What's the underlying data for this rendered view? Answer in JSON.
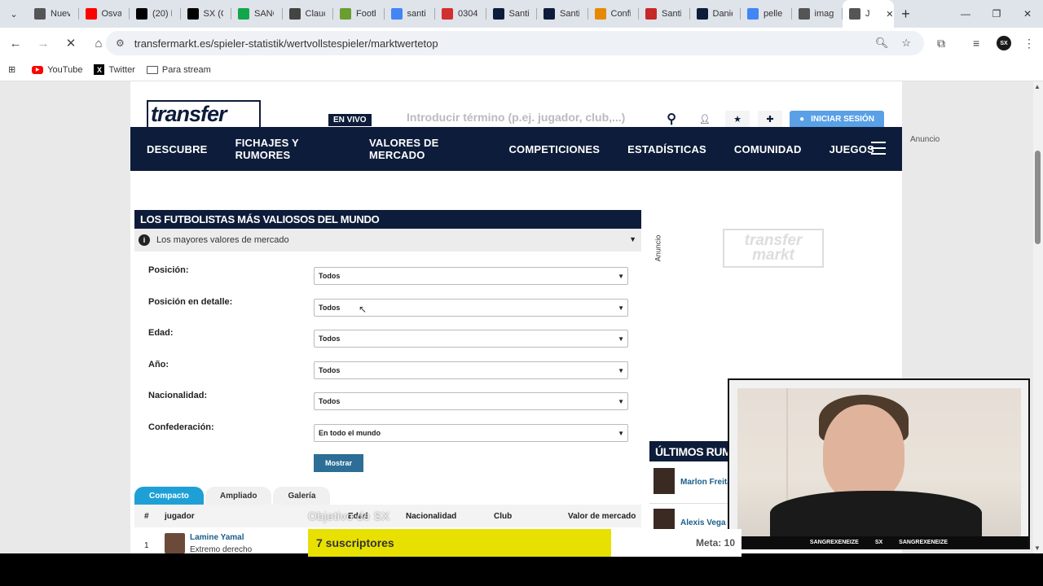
{
  "browser": {
    "tabs": [
      {
        "title": "Nuev",
        "color": "#555"
      },
      {
        "title": "Osval",
        "color": "#ff0000"
      },
      {
        "title": "(20) E",
        "color": "#000"
      },
      {
        "title": "SX (C",
        "color": "#000"
      },
      {
        "title": "SANC",
        "color": "#12a64b"
      },
      {
        "title": "Clauc",
        "color": "#444"
      },
      {
        "title": "Footb",
        "color": "#6a9e2f"
      },
      {
        "title": "santi",
        "color": "#4285f4"
      },
      {
        "title": "0304",
        "color": "#d32f2f"
      },
      {
        "title": "Santi",
        "color": "#0d1c3a"
      },
      {
        "title": "Santi",
        "color": "#0d1c3a"
      },
      {
        "title": "Confi",
        "color": "#e58a00"
      },
      {
        "title": "Santi",
        "color": "#c62828"
      },
      {
        "title": "Danie",
        "color": "#0d1c3a"
      },
      {
        "title": "pelle",
        "color": "#4285f4"
      },
      {
        "title": "imag",
        "color": "#555"
      },
      {
        "title": "J",
        "color": "#555"
      }
    ],
    "url": "transfermarkt.es/spieler-statistik/wertvollstespieler/marktwertetop",
    "profile_initials": "SX",
    "bookmarks": [
      {
        "label": "YouTube",
        "icon": "youtube-icon"
      },
      {
        "label": "Twitter",
        "icon": "x-icon"
      },
      {
        "label": "Para stream",
        "icon": "folder-icon"
      }
    ]
  },
  "site": {
    "logo_text": "transfer",
    "live_badge": "EN VIVO",
    "search_placeholder": "Introducir término (p.ej. jugador, club,...)",
    "login_label": "INICIAR SESIÓN",
    "nav": [
      "DESCUBRE",
      "FICHAJES Y RUMORES",
      "VALORES DE MERCADO",
      "COMPETICIONES",
      "ESTADÍSTICAS",
      "COMUNIDAD",
      "JUEGOS"
    ],
    "ad_label": "Anuncio",
    "side_ad_label": "Anuncio",
    "side_logo_line1": "transfer",
    "side_logo_line2": "markt"
  },
  "box": {
    "title": "LOS FUTBOLISTAS MÁS VALIOSOS DEL MUNDO",
    "subtitle": "Los mayores valores de mercado",
    "filters": [
      {
        "label": "Posición:",
        "value": "Todos"
      },
      {
        "label": "Posición en detalle:",
        "value": "Todos"
      },
      {
        "label": "Edad:",
        "value": "Todos"
      },
      {
        "label": "Año:",
        "value": "Todos"
      },
      {
        "label": "Nacionalidad:",
        "value": "Todos"
      },
      {
        "label": "Confederación:",
        "value": "En todo el mundo"
      }
    ],
    "submit_label": "Mostrar",
    "view_tabs": [
      "Compacto",
      "Ampliado",
      "Galería"
    ],
    "columns": [
      "#",
      "jugador",
      "Edad",
      "Nacionalidad",
      "Club",
      "Valor de mercado"
    ],
    "rows": [
      {
        "rank": "1",
        "name": "Lamine Yamal",
        "position": "Extremo derecho"
      }
    ]
  },
  "rumores": {
    "title": "ÚLTIMOS RUMORES",
    "items": [
      "Marlon Freitas",
      "Alexis Vega"
    ]
  },
  "overlay": {
    "goal_title": "Objetivo de SX",
    "count_text": "7 suscriptores",
    "meta_text": "Meta: 10",
    "progress": 0.7,
    "cam_handle_1": "SANGREXENEIZE",
    "cam_logo": "SX",
    "cam_handle_2": "SANGREXENEIZE"
  }
}
